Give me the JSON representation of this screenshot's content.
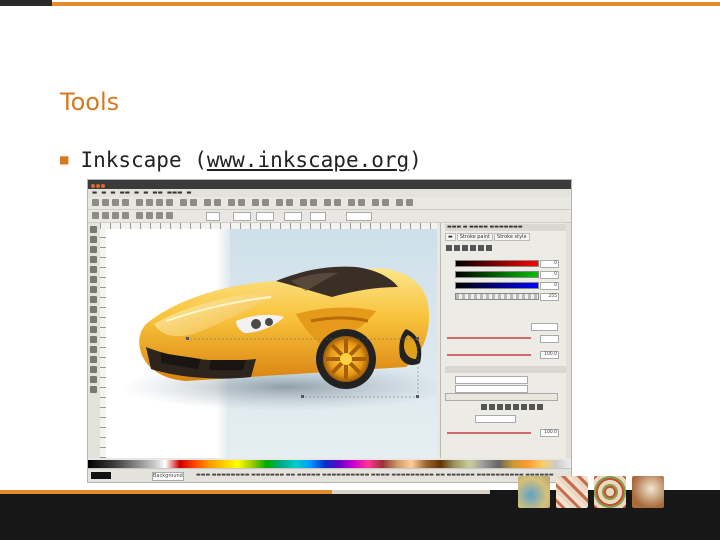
{
  "slide": {
    "title": "Tools",
    "bullet_prefix": "Inkscape (",
    "bullet_link": "www.inkscape.org",
    "bullet_suffix": ")"
  },
  "colors": {
    "accent": "#e38a2c",
    "title": "#d57a1f",
    "footer": "#171717"
  },
  "screenshot": {
    "app": "Inkscape",
    "side_panel_tabs": [
      "Stroke paint",
      "Stroke style"
    ],
    "panel_values": [
      "0",
      "0",
      "0",
      "255",
      "100.0",
      "100.0"
    ],
    "layer": "Background"
  }
}
